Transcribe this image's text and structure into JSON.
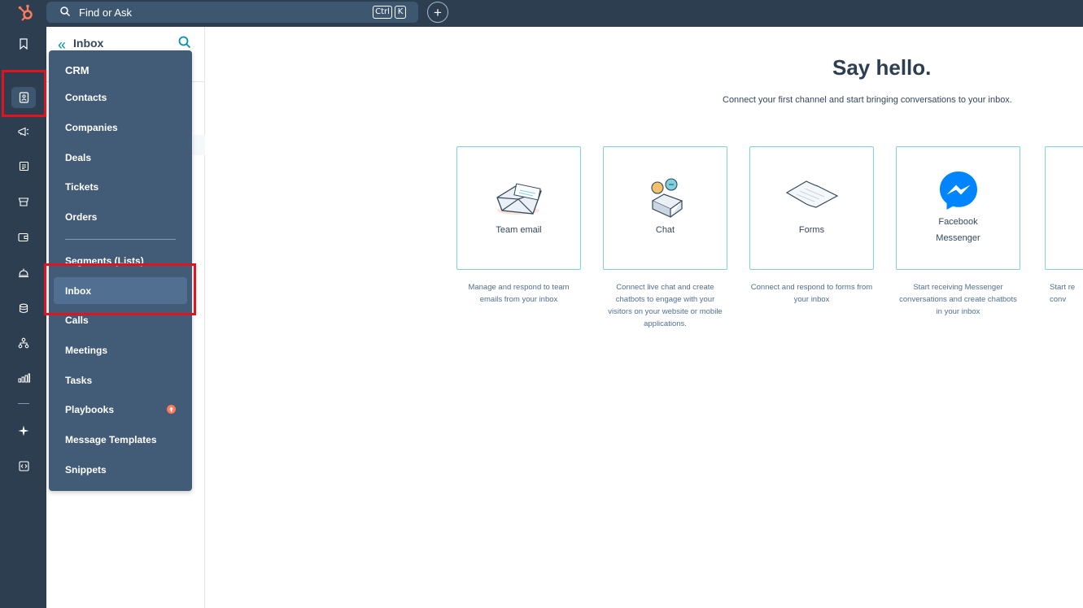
{
  "topbar": {
    "search_placeholder": "Find or Ask",
    "kbd_ctrl": "Ctrl",
    "kbd_k": "K",
    "add_label": "+"
  },
  "leftnav": {
    "icons": [
      "bookmark-icon",
      "contacts-icon",
      "megaphone-icon",
      "content-icon",
      "commerce-icon",
      "wallet-icon",
      "service-bell-icon",
      "database-icon",
      "workflows-icon",
      "reports-icon",
      "sparkle-icon",
      "code-icon"
    ]
  },
  "panel": {
    "back": "«",
    "title": "Inbox"
  },
  "flyout": {
    "heading": "CRM",
    "items": [
      "Contacts",
      "Companies",
      "Deals",
      "Tickets",
      "Orders",
      "Segments (Lists)",
      "Inbox",
      "Calls",
      "Meetings",
      "Tasks",
      "Playbooks",
      "Message Templates",
      "Snippets"
    ],
    "selected": "Inbox"
  },
  "main": {
    "title": "Say hello.",
    "subtitle": "Connect your first channel and start bringing conversations to your inbox.",
    "cards": [
      {
        "label": "Team email",
        "desc": "Manage and respond to team emails from your inbox"
      },
      {
        "label": "Chat",
        "desc": "Connect live chat and create chatbots to engage with your visitors on your website or mobile applications."
      },
      {
        "label": "Forms",
        "desc": "Connect and respond to forms from your inbox"
      },
      {
        "label": "Facebook Messenger",
        "desc": "Start receiving Messenger conversations and create chatbots in your inbox"
      },
      {
        "label": "",
        "desc": "Start re conv"
      }
    ]
  },
  "colors": {
    "topbar": "#2d3e50",
    "flyout": "#425b76",
    "accent": "#0091ae",
    "highlight": "#e0141e",
    "card_border": "#7fd1de"
  }
}
